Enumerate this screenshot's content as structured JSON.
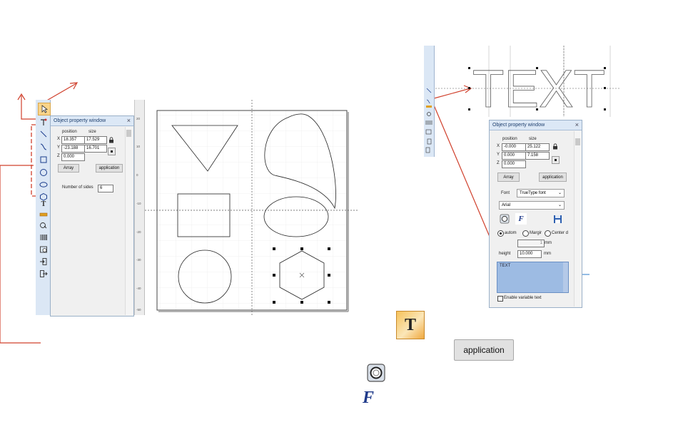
{
  "toolbar_left": {
    "tools": [
      "select-tool",
      "node-edit-tool",
      "line-tool",
      "curve-tool",
      "rectangle-tool",
      "circle-tool",
      "ellipse-tool",
      "polygon-tool",
      "text-tool",
      "barcode-tool",
      "image-tool",
      "qr-tool",
      "timer-tool",
      "input-port-tool",
      "output-port-tool"
    ]
  },
  "panel_left": {
    "title": "Object property window",
    "close": "×",
    "position_label": "position",
    "size_label": "size",
    "axis_x": "X",
    "axis_y": "Y",
    "axis_z": "Z",
    "x_value": "18.357",
    "y_value": "-23.188",
    "z_value": "0.000",
    "w_value": "17.529",
    "h_value": "16.701",
    "array_label": "Array",
    "application_label": "application",
    "sides_label": "Number of sides",
    "sides_value": "6"
  },
  "canvas": {
    "ruler_labels": [
      "20",
      "10",
      "0",
      "-10",
      "-20",
      "-30",
      "-40",
      "-50"
    ]
  },
  "right_view": {
    "text_object": "TEXT"
  },
  "panel_right": {
    "title": "Object property window",
    "close": "×",
    "position_label": "position",
    "size_label": "size",
    "axis_x": "X",
    "axis_y": "Y",
    "axis_z": "Z",
    "x_value": "-0.000",
    "y_value": "0.000",
    "z_value": "0.000",
    "w_value": "25.122",
    "h_value": "7.158",
    "array_label": "Array",
    "application_label": "application",
    "font_label": "Font",
    "font_type": "TrueType font",
    "font_name": "Arial",
    "radio_auto": "autom",
    "radio_margin": "Margir",
    "radio_center": "Center d",
    "spacing_value": "1",
    "spacing_unit": "mm",
    "height_label": "height",
    "height_value": "10.000",
    "height_unit": "mm",
    "text_content": "TEXT",
    "variable_text_label": "Enable variable text"
  },
  "legend": {
    "application_button": "application"
  },
  "colors": {
    "annotation": "#d0402c",
    "highlight": "#2a78c8",
    "toolbar": "#dbe7f5"
  }
}
